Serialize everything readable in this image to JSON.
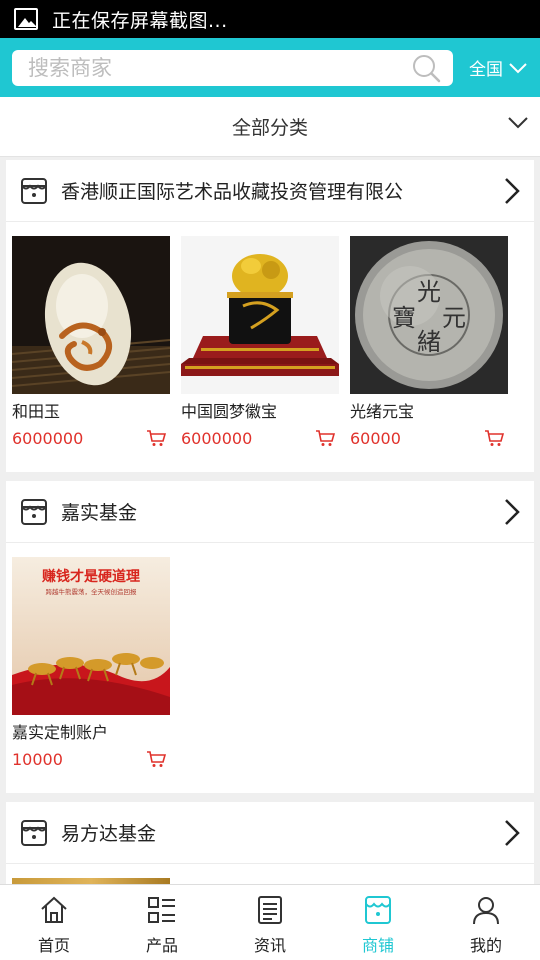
{
  "status_bar": {
    "text": "正在保存屏幕截图..."
  },
  "search": {
    "placeholder": "搜索商家",
    "region": "全国"
  },
  "category": {
    "label": "全部分类"
  },
  "stores": [
    {
      "name": "香港顺正国际艺术品收藏投资管理有限公",
      "products": [
        {
          "name": "和田玉",
          "price": "6000000"
        },
        {
          "name": "中国圆梦徽宝",
          "price": "6000000"
        },
        {
          "name": "光绪元宝",
          "price": "60000"
        }
      ]
    },
    {
      "name": "嘉实基金",
      "products": [
        {
          "name": "嘉实定制账户",
          "price": "10000",
          "banner_title": "赚钱才是硬道理",
          "banner_sub": "跨越牛熊震荡，全天候创造回报"
        }
      ]
    },
    {
      "name": "易方达基金",
      "products": []
    }
  ],
  "tabs": [
    {
      "label": "首页",
      "icon": "home-icon"
    },
    {
      "label": "产品",
      "icon": "list-icon"
    },
    {
      "label": "资讯",
      "icon": "news-icon"
    },
    {
      "label": "商铺",
      "icon": "shop-icon",
      "active": true
    },
    {
      "label": "我的",
      "icon": "user-icon"
    }
  ],
  "colors": {
    "accent": "#1fc7d2",
    "price": "#e0322c",
    "background": "#efefef"
  }
}
